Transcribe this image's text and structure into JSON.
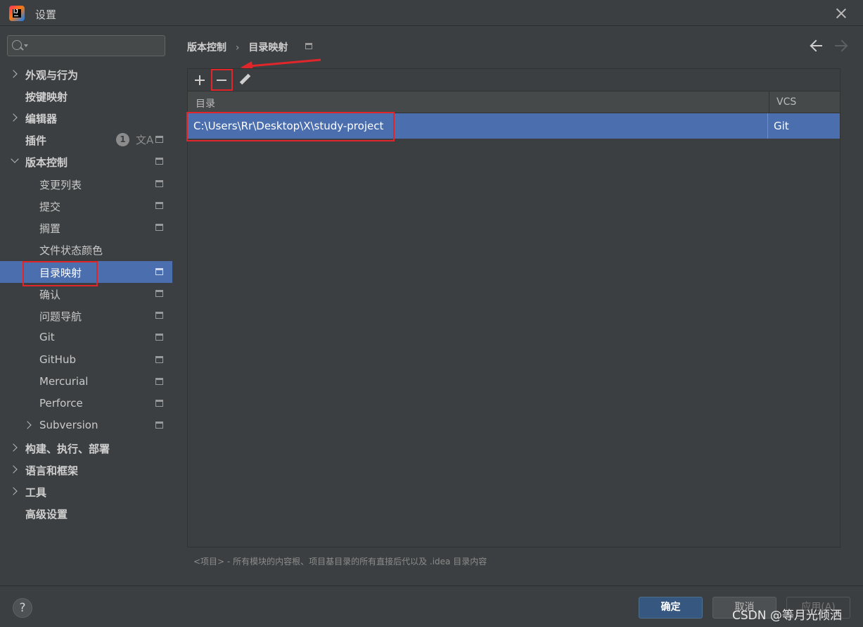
{
  "window": {
    "title": "设置",
    "close_icon": "close-icon",
    "app_icon": "intellij-idea-icon"
  },
  "sidebar": {
    "search": {
      "placeholder": "",
      "value": ""
    },
    "items": [
      {
        "label": "外观与行为",
        "expander": "collapsed"
      },
      {
        "label": "按键映射",
        "expander": "none"
      },
      {
        "label": "编辑器",
        "expander": "collapsed"
      },
      {
        "label": "插件",
        "expander": "none",
        "badge": "1"
      },
      {
        "label": "版本控制",
        "expander": "expanded"
      },
      {
        "label": "变更列表"
      },
      {
        "label": "提交"
      },
      {
        "label": "搁置"
      },
      {
        "label": "文件状态颜色"
      },
      {
        "label": "目录映射",
        "selected": true
      },
      {
        "label": "确认"
      },
      {
        "label": "问题导航"
      },
      {
        "label": "Git"
      },
      {
        "label": "GitHub"
      },
      {
        "label": "Mercurial"
      },
      {
        "label": "Perforce"
      },
      {
        "label": "Subversion",
        "expander": "collapsed"
      },
      {
        "label": "构建、执行、部署",
        "expander": "collapsed"
      },
      {
        "label": "语言和框架",
        "expander": "collapsed"
      },
      {
        "label": "工具",
        "expander": "collapsed"
      },
      {
        "label": "高级设置",
        "expander": "none"
      }
    ]
  },
  "main": {
    "breadcrumb": {
      "parent": "版本控制",
      "separator": "›",
      "current": "目录映射"
    },
    "toolbar": {
      "add_icon": "plus-icon",
      "remove_icon": "minus-icon",
      "edit_icon": "pencil-icon"
    },
    "table": {
      "columns": [
        "目录",
        "VCS"
      ],
      "rows": [
        {
          "directory": "C:\\Users\\Rr\\Desktop\\X\\study-project",
          "vcs": "Git",
          "selected": true
        }
      ]
    },
    "hint": "<项目> - 所有模块的内容根、项目基目录的所有直接后代以及 .idea 目录内容"
  },
  "footer": {
    "help_label": "?",
    "ok_label": "确定",
    "cancel_label": "取消",
    "apply_label": "应用(A)"
  },
  "watermark": "CSDN @等月光倾洒",
  "colors": {
    "background": "#3c3f41",
    "selection": "#4b6eaf",
    "annotation_red": "#e0262b",
    "ok_button": "#365880"
  }
}
